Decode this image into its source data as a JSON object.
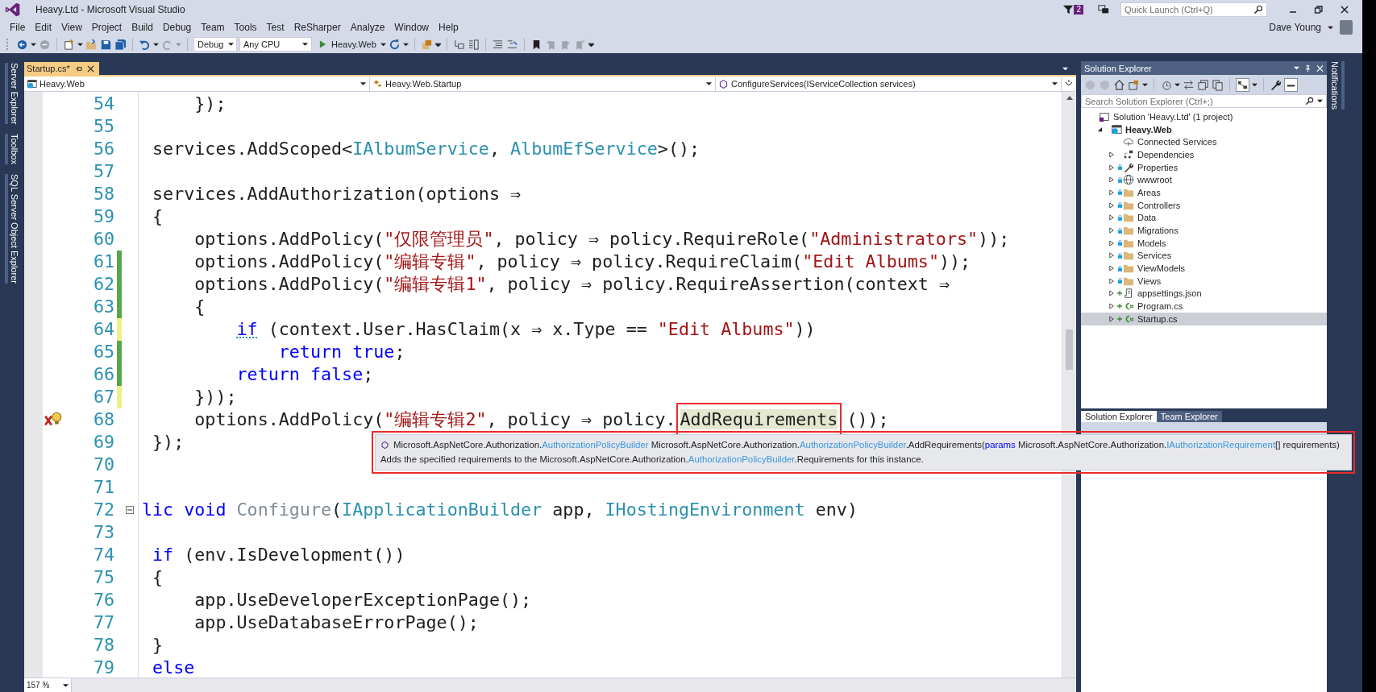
{
  "window": {
    "title": "Heavy.Ltd - Microsoft Visual Studio",
    "notification_count": "2",
    "quick_launch": {
      "placeholder": "Quick Launch (Ctrl+Q)"
    },
    "user": "Dave Young"
  },
  "menu": [
    "File",
    "Edit",
    "View",
    "Project",
    "Build",
    "Debug",
    "Team",
    "Tools",
    "Test",
    "ReSharper",
    "Analyze",
    "Window",
    "Help"
  ],
  "toolbar": {
    "configuration": "Debug",
    "platform": "Any CPU",
    "start_target": "Heavy.Web"
  },
  "left_dock_tabs": [
    "Server Explorer",
    "Toolbox",
    "SQL Server Object Explorer"
  ],
  "right_dock_tabs": [
    "Notifications"
  ],
  "editor": {
    "tabs": [
      {
        "label": "Startup.cs*",
        "selected": true
      }
    ],
    "nav": [
      "Heavy.Web",
      "Heavy.Web.Startup",
      "ConfigureServices(IServiceCollection services)"
    ],
    "lines": [
      {
        "number": "54",
        "tokens": [
          {
            "kind": "plain",
            "text": "     });"
          }
        ]
      },
      {
        "number": "55"
      },
      {
        "number": "56",
        "tokens": [
          {
            "kind": "plain",
            "text": " services.AddScoped<"
          },
          {
            "kind": "type",
            "text": "IAlbumService"
          },
          {
            "kind": "plain",
            "text": ", "
          },
          {
            "kind": "type",
            "text": "AlbumEfService"
          },
          {
            "kind": "plain",
            "text": ">();"
          }
        ]
      },
      {
        "number": "57"
      },
      {
        "number": "58",
        "tokens": [
          {
            "kind": "plain",
            "text": " services.AddAuthorization(options ⇒"
          }
        ]
      },
      {
        "number": "59",
        "tokens": [
          {
            "kind": "plain",
            "text": " {"
          }
        ]
      },
      {
        "number": "60",
        "tokens": [
          {
            "kind": "plain",
            "text": "     options.AddPolicy("
          },
          {
            "kind": "string",
            "text": "\"仅限管理员\""
          },
          {
            "kind": "plain",
            "text": ", policy ⇒ policy.RequireRole("
          },
          {
            "kind": "string",
            "text": "\"Administrators\""
          },
          {
            "kind": "plain",
            "text": "));"
          }
        ]
      },
      {
        "number": "61",
        "marker": {
          "color": "#57a64a"
        },
        "tokens": [
          {
            "kind": "plain",
            "text": "     options.AddPolicy("
          },
          {
            "kind": "string",
            "text": "\"编辑专辑\""
          },
          {
            "kind": "plain",
            "text": ", policy ⇒ policy.RequireClaim("
          },
          {
            "kind": "string",
            "text": "\"Edit Albums\""
          },
          {
            "kind": "plain",
            "text": "));"
          }
        ]
      },
      {
        "number": "62",
        "marker": {
          "color": "#57a64a"
        },
        "tokens": [
          {
            "kind": "plain",
            "text": "     options.AddPolicy("
          },
          {
            "kind": "string",
            "text": "\"编辑专辑1\""
          },
          {
            "kind": "plain",
            "text": ", policy ⇒ policy.RequireAssertion(context ⇒"
          }
        ]
      },
      {
        "number": "63",
        "marker": {
          "color": "#57a64a"
        },
        "tokens": [
          {
            "kind": "plain",
            "text": "     {"
          }
        ]
      },
      {
        "number": "64",
        "marker": {
          "color": "#efef8a"
        },
        "tokens": [
          {
            "kind": "keyword-hint",
            "text": "         if"
          },
          {
            "kind": "plain",
            "text": " (context.User.HasClaim(x ⇒ x.Type == "
          },
          {
            "kind": "string",
            "text": "\"Edit Albums\""
          },
          {
            "kind": "plain",
            "text": "))"
          }
        ]
      },
      {
        "number": "65",
        "marker": {
          "color": "#57a64a"
        },
        "tokens": [
          {
            "kind": "keyword",
            "text": "             return true"
          },
          {
            "kind": "plain",
            "text": ";"
          }
        ]
      },
      {
        "number": "66",
        "marker": {
          "color": "#57a64a"
        },
        "tokens": [
          {
            "kind": "keyword",
            "text": "         return false"
          },
          {
            "kind": "plain",
            "text": ";"
          }
        ]
      },
      {
        "number": "67",
        "marker": {
          "color": "#efef8a"
        },
        "tokens": [
          {
            "kind": "plain",
            "text": "     }));"
          }
        ]
      },
      {
        "number": "68",
        "lightbulb": true,
        "tokens": [
          {
            "kind": "plain",
            "text": "     options.AddPolicy("
          },
          {
            "kind": "string",
            "text": "\"编辑专辑2\""
          },
          {
            "kind": "plain",
            "text": ", policy ⇒ policy."
          },
          {
            "kind": "ref-framed",
            "text": "AddRequirements"
          },
          {
            "kind": "plain",
            "text": "());"
          }
        ]
      },
      {
        "number": "69",
        "tokens": [
          {
            "kind": "plain",
            "text": " });"
          }
        ]
      },
      {
        "number": "70"
      },
      {
        "number": "71"
      },
      {
        "number": "72",
        "collapsible": true,
        "tokens": [
          {
            "kind": "keyword",
            "text": "lic void"
          },
          {
            "kind": "dim",
            "text": " Configure"
          },
          {
            "kind": "plain",
            "text": "("
          },
          {
            "kind": "type",
            "text": "IApplicationBuilder"
          },
          {
            "kind": "plain",
            "text": " app, "
          },
          {
            "kind": "type",
            "text": "IHostingEnvironment"
          },
          {
            "kind": "plain",
            "text": " env)"
          }
        ]
      },
      {
        "number": "73"
      },
      {
        "number": "74",
        "tokens": [
          {
            "kind": "keyword",
            "text": " if"
          },
          {
            "kind": "plain",
            "text": " (env.IsDevelopment())"
          }
        ]
      },
      {
        "number": "75",
        "tokens": [
          {
            "kind": "plain",
            "text": " {"
          }
        ]
      },
      {
        "number": "76",
        "tokens": [
          {
            "kind": "plain",
            "text": "     app.UseDeveloperExceptionPage();"
          }
        ]
      },
      {
        "number": "77",
        "tokens": [
          {
            "kind": "plain",
            "text": "     app.UseDatabaseErrorPage();"
          }
        ]
      },
      {
        "number": "78",
        "tokens": [
          {
            "kind": "plain",
            "text": " }"
          }
        ]
      },
      {
        "number": "79",
        "tokens": [
          {
            "kind": "keyword",
            "text": " else"
          }
        ]
      }
    ],
    "zoom": "157 %"
  },
  "tooltip": {
    "framed": true,
    "lines": [
      {
        "tokens": [
          {
            "kind": "plain",
            "text": "Microsoft.AspNetCore.Authorization."
          },
          {
            "kind": "type",
            "text": "AuthorizationPolicyBuilder"
          },
          {
            "kind": "plain",
            "text": " Microsoft.AspNetCore.Authorization."
          },
          {
            "kind": "type",
            "text": "AuthorizationPolicyBuilder"
          },
          {
            "kind": "plain",
            "text": ".AddRequirements("
          },
          {
            "kind": "keyword",
            "text": "params"
          },
          {
            "kind": "plain",
            "text": " Microsoft.AspNetCore.Authorization."
          },
          {
            "kind": "type",
            "text": "IAuthorizationRequirement"
          },
          {
            "kind": "plain",
            "text": "[] requirements)"
          }
        ]
      },
      {
        "tokens": [
          {
            "kind": "plain",
            "text": "Adds the specified requirements to the Microsoft.AspNetCore.Authorization."
          },
          {
            "kind": "type",
            "text": "AuthorizationPolicyBuilder"
          },
          {
            "kind": "plain",
            "text": ".Requirements for this instance."
          }
        ]
      }
    ]
  },
  "solution_explorer": {
    "title": "Solution Explorer",
    "search": {
      "placeholder": "Search Solution Explorer (Ctrl+;)"
    },
    "tree": [
      {
        "label": "Solution 'Heavy.Ltd' (1 project)",
        "kind": "solution",
        "selected": false,
        "children": [
          {
            "label": "Heavy.Web",
            "kind": "project",
            "expanded": true,
            "selected": false,
            "children": [
              {
                "label": "Connected Services",
                "kind": "cloud",
                "selected": false
              },
              {
                "label": "Dependencies",
                "kind": "deps",
                "expanded": false,
                "selected": false
              },
              {
                "label": "Properties",
                "kind": "wrench",
                "checked_in": true,
                "expanded": false,
                "selected": false
              },
              {
                "label": "wwwroot",
                "kind": "globe",
                "checked_in": true,
                "expanded": false,
                "selected": false
              },
              {
                "label": "Areas",
                "kind": "folder",
                "checked_in": true,
                "expanded": false,
                "selected": false
              },
              {
                "label": "Controllers",
                "kind": "folder",
                "checked_in": true,
                "expanded": false,
                "selected": false
              },
              {
                "label": "Data",
                "kind": "folder",
                "checked_in": true,
                "expanded": false,
                "selected": false
              },
              {
                "label": "Migrations",
                "kind": "folder",
                "checked_in": true,
                "expanded": false,
                "selected": false
              },
              {
                "label": "Models",
                "kind": "folder",
                "checked_in": true,
                "expanded": false,
                "selected": false
              },
              {
                "label": "Services",
                "kind": "folder",
                "checked_in": true,
                "expanded": false,
                "selected": false
              },
              {
                "label": "ViewModels",
                "kind": "folder",
                "checked_in": true,
                "expanded": false,
                "selected": false
              },
              {
                "label": "Views",
                "kind": "folder",
                "checked_in": true,
                "expanded": false,
                "selected": false
              },
              {
                "label": "appsettings.json",
                "kind": "json",
                "pending_add": true,
                "expanded": false,
                "selected": false
              },
              {
                "label": "Program.cs",
                "kind": "cs",
                "pending_add": true,
                "expanded": false,
                "selected": false
              },
              {
                "label": "Startup.cs",
                "kind": "cs",
                "pending_add": true,
                "expanded": false,
                "selected": true
              }
            ]
          }
        ]
      }
    ],
    "tabs": [
      {
        "label": "Solution Explorer",
        "selected": true
      },
      {
        "label": "Team Explorer",
        "selected": false
      }
    ]
  }
}
